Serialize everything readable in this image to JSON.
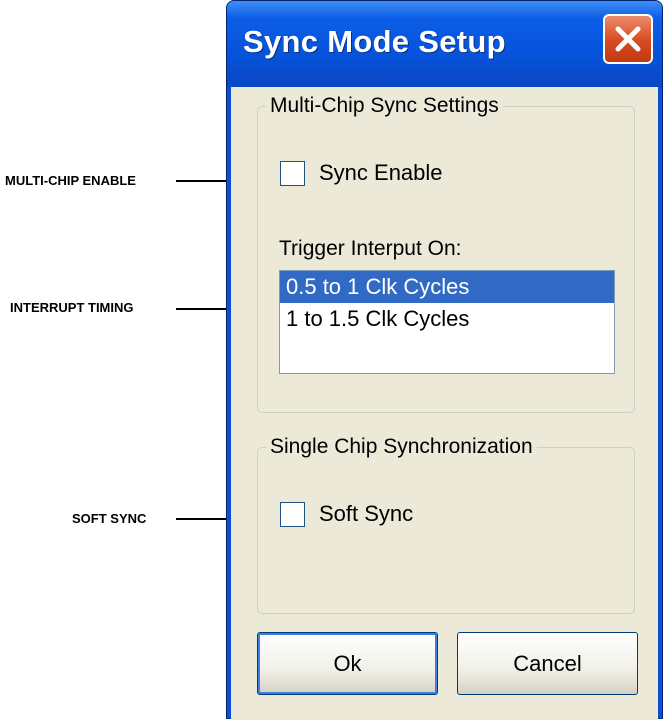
{
  "window": {
    "title": "Sync Mode Setup"
  },
  "multi_chip": {
    "legend": "Multi-Chip Sync Settings",
    "sync_enable": {
      "label": "Sync Enable",
      "checked": false
    },
    "trigger_label": "Trigger Interput On:",
    "trigger_options": [
      "0.5 to 1 Clk Cycles",
      "1 to 1.5 Clk Cycles"
    ],
    "selected_option": "0.5 to 1 Clk Cycles"
  },
  "single_chip": {
    "legend": "Single Chip Synchronization",
    "soft_sync": {
      "label": "Soft Sync",
      "checked": false
    }
  },
  "buttons": {
    "ok": "Ok",
    "cancel": "Cancel"
  },
  "callouts": {
    "multi_chip_enable": "MULTI-CHIP ENABLE",
    "interrupt_timing": "INTERRUPT TIMING",
    "soft_sync": "SOFT SYNC"
  },
  "colors": {
    "titlebar": "#0654dd",
    "dialog_face": "#ece9d8",
    "selection": "#316ac5",
    "close_button": "#d74a22"
  },
  "icons": {
    "close": "close-icon"
  }
}
